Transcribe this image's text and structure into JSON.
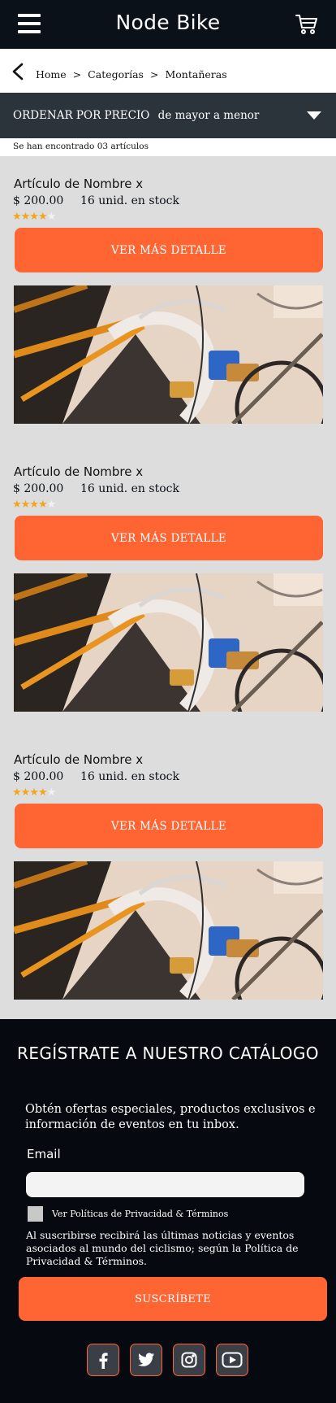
{
  "header": {
    "title": "Node Bike",
    "menu_icon": "hamburger-menu-icon",
    "cart_icon": "shopping-cart-icon"
  },
  "breadcrumb": {
    "back_icon": "chevron-left-icon",
    "items": [
      "Home",
      "Categorías",
      "Montañeras"
    ],
    "separator": ">"
  },
  "sort": {
    "label": "ORDENAR POR PRECIO",
    "value": "de mayor a menor",
    "icon": "caret-down-icon"
  },
  "results": {
    "text": "Se han encontrado 03 artículos"
  },
  "products": [
    {
      "name": "Artículo de Nombre x",
      "price": "$ 200.00",
      "stock": "16 unid. en stock",
      "rating": 4,
      "max_rating": 5,
      "button": "VER MÁS DETALLE"
    },
    {
      "name": "Artículo de Nombre x",
      "price": "$ 200.00",
      "stock": "16 unid. en stock",
      "rating": 4,
      "max_rating": 5,
      "button": "VER MÁS DETALLE"
    },
    {
      "name": "Artículo de Nombre x",
      "price": "$ 200.00",
      "stock": "16 unid. en stock",
      "rating": 4,
      "max_rating": 5,
      "button": "VER MÁS DETALLE"
    }
  ],
  "footer": {
    "title": "REGÍSTRATE A NUESTRO CATÁLOGO",
    "subtitle": "Obtén ofertas especiales, productos exclusivos e información de eventos en tu inbox.",
    "email_label": "Email",
    "email_value": "",
    "email_placeholder": "",
    "checkbox_label": "Ver Políticas de Privacidad & Términos",
    "checkbox_checked": false,
    "disclaimer": "Al suscribirse recibirá las últimas noticias y eventos asociados al mundo del ciclismo; según la Política de Privacidad & Términos.",
    "button": "SUSCRÍBETE",
    "social": [
      "facebook-icon",
      "twitter-icon",
      "instagram-icon",
      "youtube-icon"
    ]
  },
  "colors": {
    "header_bg": "#0b1119",
    "accent": "#ff6433",
    "sort_bg": "#2b333b",
    "page_bg": "#dddddd",
    "star": "#f3a51d",
    "footer_bg": "#060a10"
  }
}
